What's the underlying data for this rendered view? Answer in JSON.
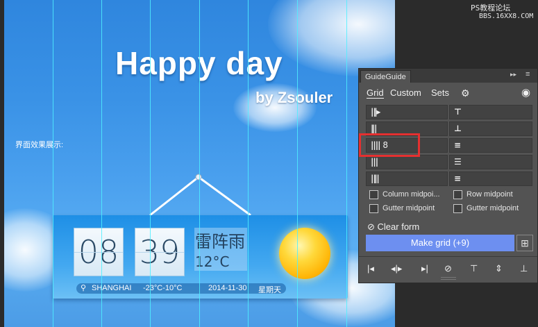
{
  "watermark": {
    "line1": "PS教程论坛",
    "line2": "BBS.16XX8.COM"
  },
  "design": {
    "title": "Happy day",
    "byline": "by Zsouler",
    "side_label": "界面效果展示:",
    "widget": {
      "hour": "08",
      "minute": "39",
      "condition": "雷阵雨",
      "temperature": "12°C",
      "location_pin": "⚲",
      "city": "SHANGHAI",
      "temp_range": "-23°C-10°C",
      "date": "2014-11-30",
      "weekday": "星期天",
      "sun_icon": "sun-icon"
    }
  },
  "panel": {
    "tab": "GuideGuide",
    "collapse_icon": "▸▸",
    "menu_icon": "≡",
    "nav": {
      "grid": "Grid",
      "custom": "Custom",
      "sets": "Sets"
    },
    "settings_icon": "⚙",
    "visibility_icon": "◉",
    "fields": {
      "col_left": [
        "|‖▸",
        "‖|",
        "||||",
        "|||",
        "|‖|"
      ],
      "col_left_value": "8",
      "col_right": [
        "⊤",
        "⊥",
        "≡",
        "☰",
        "≡"
      ]
    },
    "checkboxes": {
      "column_midpoint": "Column midpoi...",
      "row_midpoint": "Row midpoint",
      "gutter_midpoint_left": "Gutter midpoint",
      "gutter_midpoint_right": "Gutter midpoint"
    },
    "clear_form": "Clear form",
    "clear_icon": "⊘",
    "make_grid": "Make grid (+9)",
    "grid_icon": "⊞",
    "toolbar": [
      "|◂",
      "◂|▸",
      "▸|",
      "⊘",
      "⊤",
      "⇕",
      "⊥"
    ]
  }
}
